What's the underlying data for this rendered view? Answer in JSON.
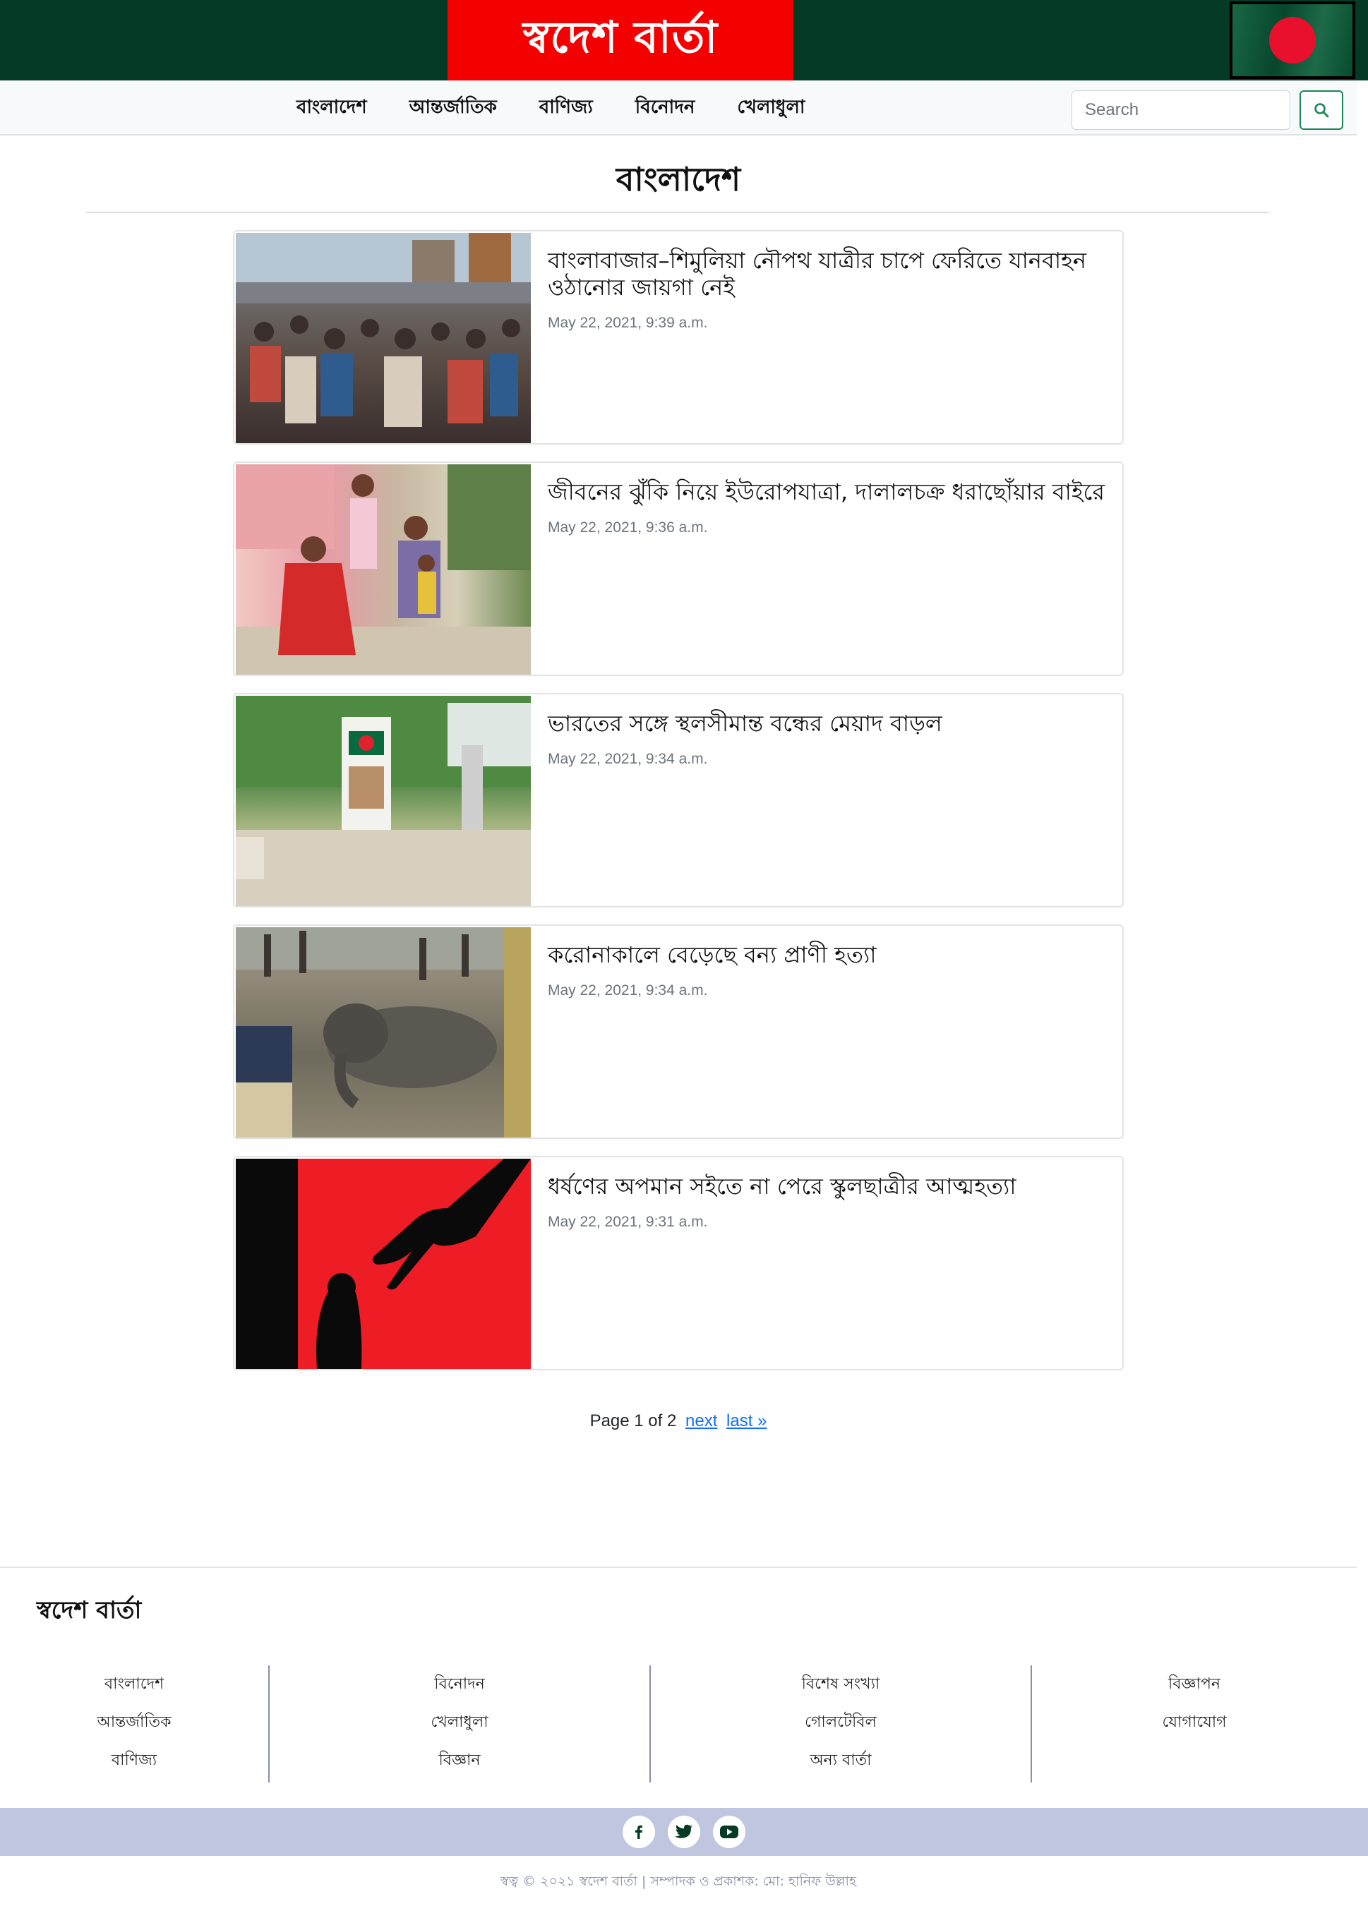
{
  "header": {
    "brand": "স্বদেশ বার্তা",
    "flag_colors": {
      "field": "#0a5e3a",
      "disc": "#e8102c"
    },
    "colors": {
      "topbar": "#053b26",
      "brand_box": "#f40000"
    }
  },
  "nav": {
    "items": [
      {
        "label": "বাংলাদেশ"
      },
      {
        "label": "আন্তর্জাতিক"
      },
      {
        "label": "বাণিজ্য"
      },
      {
        "label": "বিনোদন"
      },
      {
        "label": "খেলাধুলা"
      }
    ],
    "search": {
      "placeholder": "Search",
      "value": "",
      "icon": "search-icon"
    }
  },
  "section": {
    "title": "বাংলাদেশ"
  },
  "articles": [
    {
      "title": "বাংলাবাজার–শিমুলিয়া নৌপথ যাত্রীর চাপে ফেরিতে যানবাহন ওঠানোর জায়গা নেই",
      "date": "May 22, 2021, 9:39 a.m."
    },
    {
      "title": "জীবনের ঝুঁকি নিয়ে ইউরোপযাত্রা, দালালচক্র ধরাছোঁয়ার বাইরে",
      "date": "May 22, 2021, 9:36 a.m."
    },
    {
      "title": "ভারতের সঙ্গে স্থলসীমান্ত বন্ধের মেয়াদ বাড়ল",
      "date": "May 22, 2021, 9:34 a.m."
    },
    {
      "title": "করোনাকালে বেড়েছে বন্য প্রাণী হত্যা",
      "date": "May 22, 2021, 9:34 a.m."
    },
    {
      "title": "ধর্ষণের অপমান সইতে না পেরে স্কুলছাত্রীর আত্মহত্যা",
      "date": "May 22, 2021, 9:31 a.m."
    }
  ],
  "pagination": {
    "text": "Page 1 of 2",
    "next": "next",
    "last": "last »"
  },
  "footer": {
    "brand": "স্বদেশ বার্তা",
    "columns": [
      [
        "বাংলাদেশ",
        "আন্তর্জাতিক",
        "বাণিজ্য"
      ],
      [
        "বিনোদন",
        "খেলাধুলা",
        "বিজ্ঞান"
      ],
      [
        "বিশেষ সংখ্যা",
        "গোলটেবিল",
        "অন্য বার্তা"
      ],
      [
        "বিজ্ঞাপন",
        "যোগাযোগ"
      ]
    ],
    "social": [
      {
        "icon": "facebook-icon"
      },
      {
        "icon": "twitter-icon"
      },
      {
        "icon": "youtube-icon"
      }
    ],
    "social_color": "#053b26",
    "copyright": "স্বত্ব © ২০২১ স্বদেশ বার্তা | সম্পাদক ও প্রকাশক: মো: হানিফ উল্লাহ"
  }
}
